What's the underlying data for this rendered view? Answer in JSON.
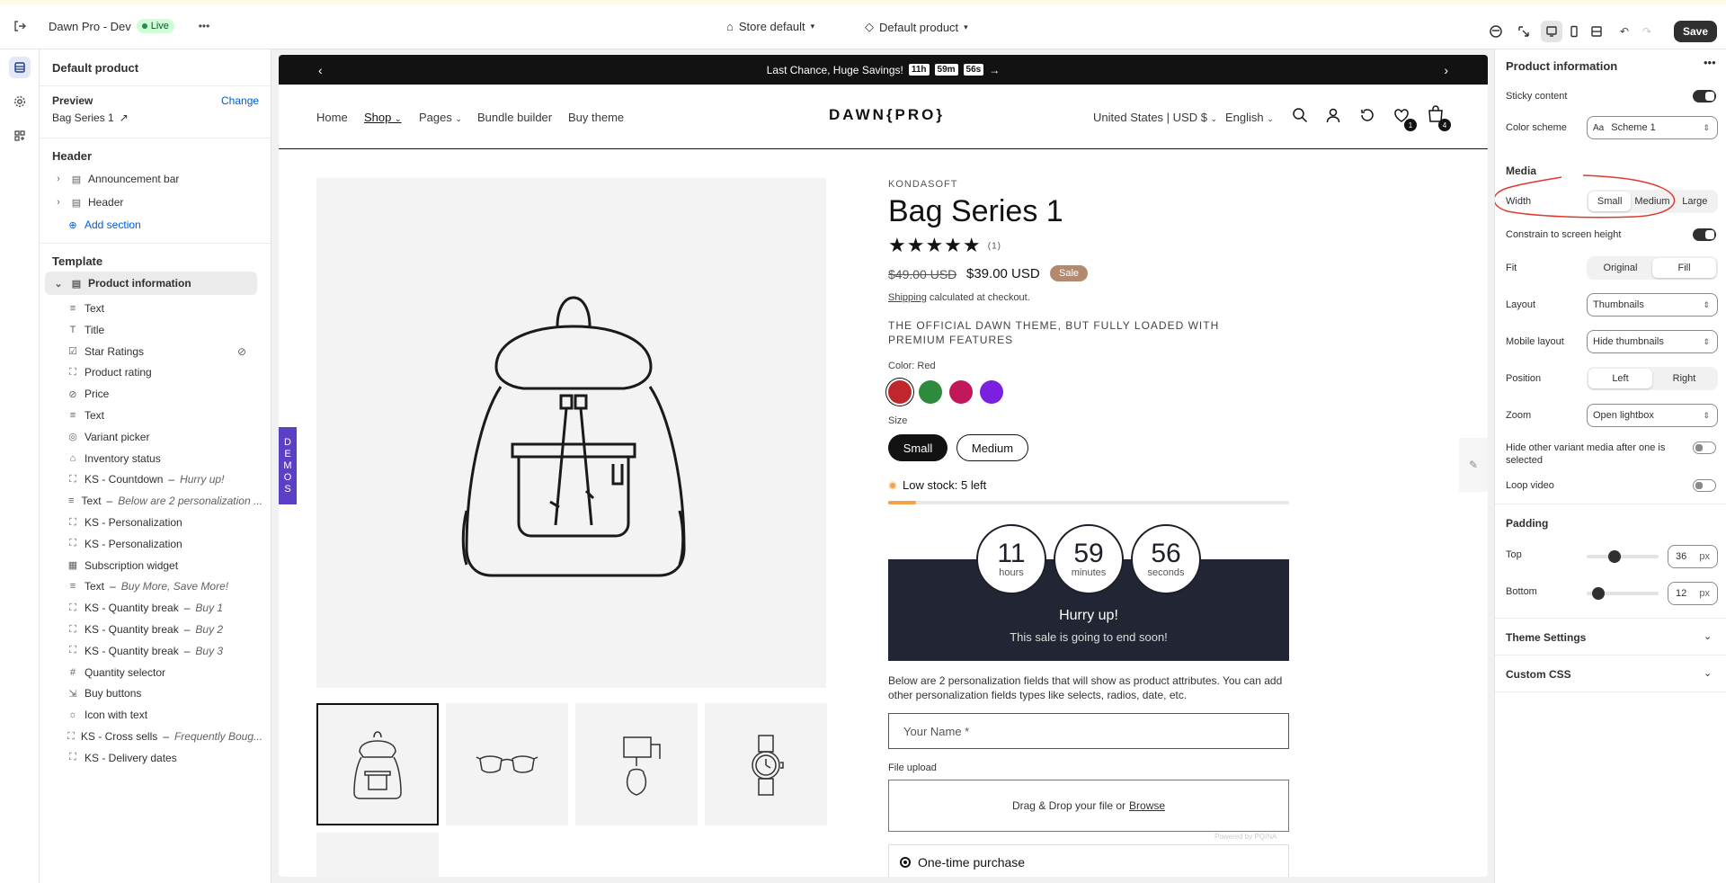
{
  "topbar": {
    "store_name": "Dawn Pro - Dev",
    "live_label": "Live",
    "store_selector": "Store default",
    "template_selector": "Default product",
    "save_label": "Save"
  },
  "sidebar": {
    "title": "Default product",
    "preview_label": "Preview",
    "change_label": "Change",
    "preview_product": "Bag Series 1",
    "header_heading": "Header",
    "header_items": [
      {
        "label": "Announcement bar"
      },
      {
        "label": "Header"
      }
    ],
    "add_section": "Add section",
    "template_heading": "Template",
    "template_section": "Product information",
    "blocks": [
      {
        "label": "Text",
        "sub": ""
      },
      {
        "label": "Title",
        "sub": ""
      },
      {
        "label": "Star Ratings",
        "sub": ""
      },
      {
        "label": "Product rating",
        "sub": ""
      },
      {
        "label": "Price",
        "sub": ""
      },
      {
        "label": "Text",
        "sub": ""
      },
      {
        "label": "Variant picker",
        "sub": ""
      },
      {
        "label": "Inventory status",
        "sub": ""
      },
      {
        "label": "KS - Countdown",
        "sub": "Hurry up!"
      },
      {
        "label": "Text",
        "sub": "Below are 2 personalization ..."
      },
      {
        "label": "KS - Personalization",
        "sub": ""
      },
      {
        "label": "KS - Personalization",
        "sub": ""
      },
      {
        "label": "Subscription widget",
        "sub": ""
      },
      {
        "label": "Text",
        "sub": "Buy More, Save More!"
      },
      {
        "label": "KS - Quantity break",
        "sub": "Buy 1"
      },
      {
        "label": "KS - Quantity break",
        "sub": "Buy 2"
      },
      {
        "label": "KS - Quantity break",
        "sub": "Buy 3"
      },
      {
        "label": "Quantity selector",
        "sub": ""
      },
      {
        "label": "Buy buttons",
        "sub": ""
      },
      {
        "label": "Icon with text",
        "sub": ""
      },
      {
        "label": "KS - Cross sells",
        "sub": "Frequently Boug..."
      },
      {
        "label": "KS - Delivery dates",
        "sub": ""
      }
    ]
  },
  "store": {
    "announcement": "Last Chance, Huge Savings!",
    "timer": [
      "11h",
      "59m",
      "56s"
    ],
    "nav": [
      "Home",
      "Shop",
      "Pages",
      "Bundle builder",
      "Buy theme"
    ],
    "logo": "DAWN{PRO}",
    "currency": "United States | USD $",
    "language": "English",
    "wishlist_count": "1",
    "cart_count": "4",
    "demos_tab": "DEMOS",
    "vendor": "KONDASOFT",
    "title": "Bag Series 1",
    "stars": "★★★★★",
    "review_count": "(1)",
    "compare_price": "$49.00 USD",
    "price": "$39.00 USD",
    "sale_badge": "Sale",
    "shipping_link": "Shipping",
    "shipping_text": "calculated at checkout.",
    "tagline": "THE OFFICIAL DAWN THEME, BUT FULLY LOADED WITH PREMIUM FEATURES",
    "color_label": "Color: Red",
    "swatches": [
      "#c0272d",
      "#2e8b3e",
      "#c2185b",
      "#7b1fe0"
    ],
    "size_label": "Size",
    "sizes": [
      "Small",
      "Medium"
    ],
    "stock_text": "Low stock: 5 left",
    "stock_fraction": 0.07,
    "countdown": [
      {
        "value": "11",
        "unit": "hours"
      },
      {
        "value": "59",
        "unit": "minutes"
      },
      {
        "value": "56",
        "unit": "seconds"
      }
    ],
    "hurry_title": "Hurry up!",
    "hurry_sub": "This sale is going to end soon!",
    "personalization_text": "Below are 2 personalization fields that will show as product attributes. You can add other personalization fields types like selects, radios, date, etc.",
    "name_placeholder": "Your Name *",
    "file_upload_label": "File upload",
    "dropzone_text": "Drag & Drop your file or",
    "browse_link": "Browse",
    "powered_by": "Powered by PQINA",
    "purchase_option": "One-time purchase"
  },
  "settings": {
    "title": "Product information",
    "sticky_content": "Sticky content",
    "color_scheme_label": "Color scheme",
    "color_scheme_value": "Scheme 1",
    "media_heading": "Media",
    "width_label": "Width",
    "width_options": [
      "Small",
      "Medium",
      "Large"
    ],
    "constrain_label": "Constrain to screen height",
    "fit_label": "Fit",
    "fit_options": [
      "Original",
      "Fill"
    ],
    "layout_label": "Layout",
    "layout_value": "Thumbnails",
    "mobile_layout_label": "Mobile layout",
    "mobile_layout_value": "Hide thumbnails",
    "position_label": "Position",
    "position_options": [
      "Left",
      "Right"
    ],
    "zoom_label": "Zoom",
    "zoom_value": "Open lightbox",
    "hide_variant_label": "Hide other variant media after one is selected",
    "loop_video_label": "Loop video",
    "padding_heading": "Padding",
    "top_label": "Top",
    "top_value": "36",
    "bottom_label": "Bottom",
    "bottom_value": "12",
    "unit": "px",
    "theme_settings": "Theme Settings",
    "custom_css": "Custom CSS"
  }
}
